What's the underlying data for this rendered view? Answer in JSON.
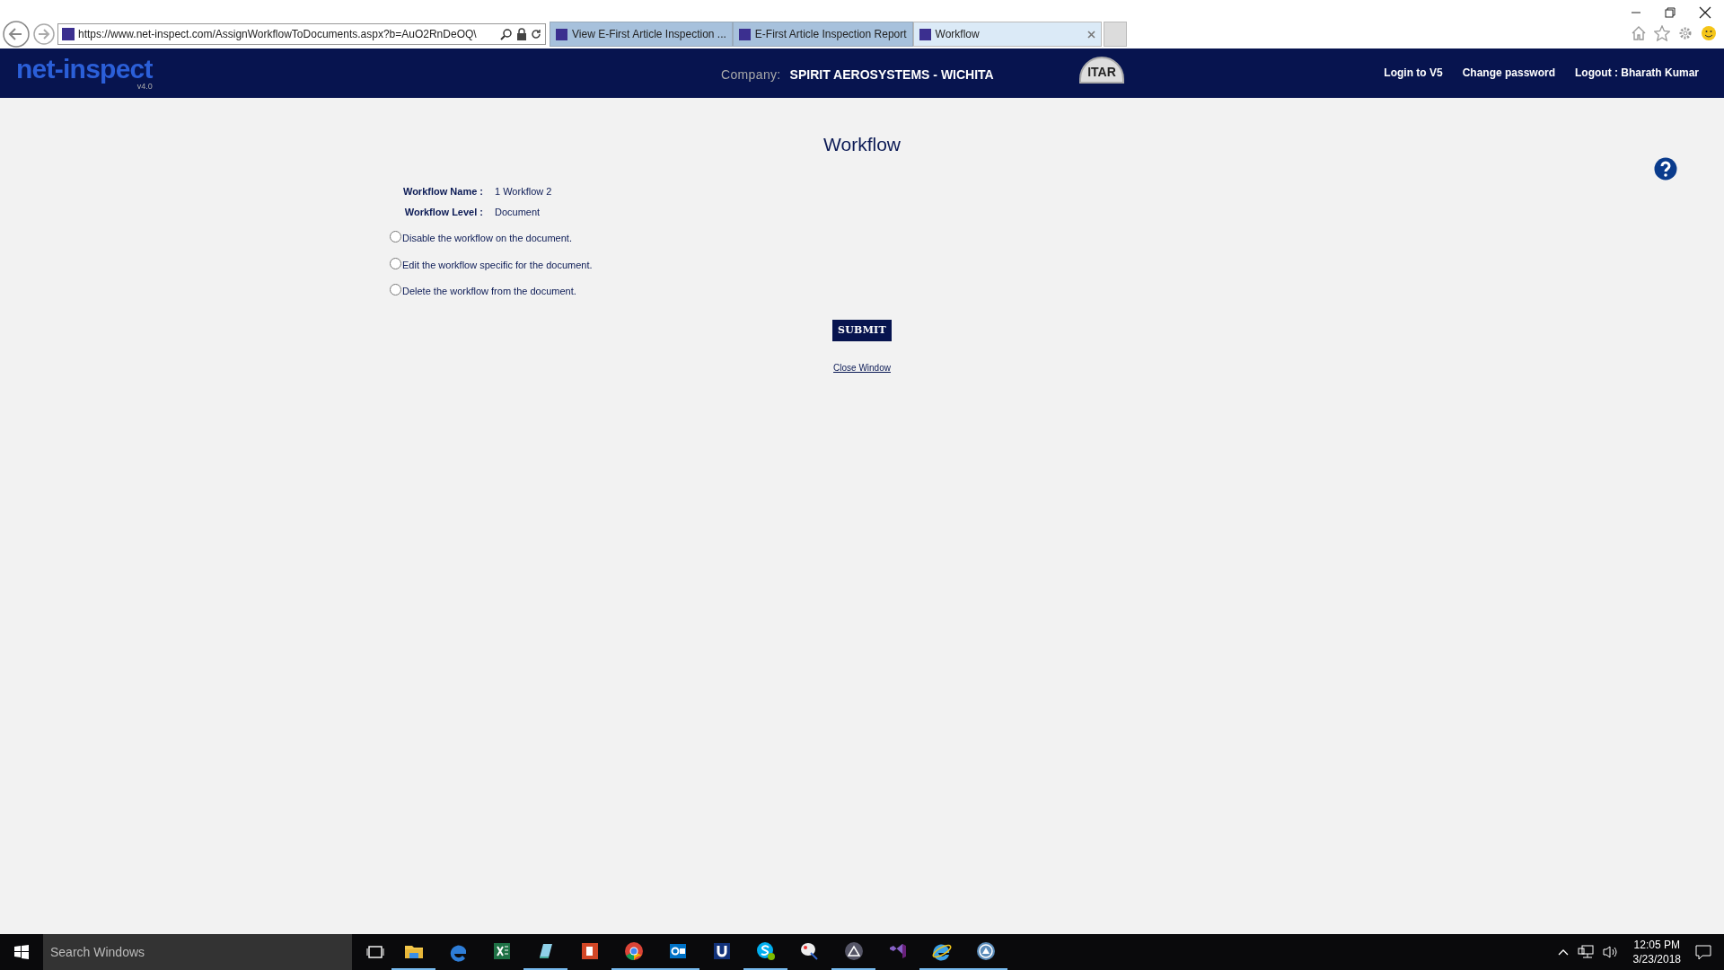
{
  "browser": {
    "address": "https://www.net-inspect.com/AssignWorkflowToDocuments.aspx?b=AuO2RnDeOQ\\",
    "tabs": [
      {
        "label": "View E-First Article Inspection ...",
        "selected": false
      },
      {
        "label": "E-First Article Inspection Report",
        "selected": false
      },
      {
        "label": "Workflow",
        "selected": true
      }
    ]
  },
  "header": {
    "logo": "net-inspect",
    "version": "v4.0",
    "company_label": "Company:",
    "company": "SPIRIT AEROSYSTEMS - WICHITA",
    "badge": "ITAR",
    "links": [
      "Login to V5",
      "Change password",
      "Logout : Bharath Kumar"
    ]
  },
  "page": {
    "title": "Workflow",
    "fields": [
      {
        "label": "Workflow Name :",
        "value": "1 Workflow 2"
      },
      {
        "label": "Workflow Level :",
        "value": "Document"
      }
    ],
    "options": [
      {
        "label": "Disable the workflow on the document.",
        "selected": false
      },
      {
        "label": "Edit the workflow specific for the document.",
        "selected": false
      },
      {
        "label": "Delete the workflow from the document.",
        "selected": false
      }
    ],
    "submit": "SUBMIT",
    "close_link": "Close Window"
  },
  "taskbar": {
    "search": {
      "placeholder": "Search Windows"
    },
    "apps": [
      {
        "kind": "folder",
        "running": true
      },
      {
        "kind": "edge",
        "running": false
      },
      {
        "kind": "excel",
        "running": false
      },
      {
        "kind": "notepad",
        "running": true
      },
      {
        "kind": "powerpoint",
        "running": false
      },
      {
        "kind": "chrome",
        "running": true
      },
      {
        "kind": "outlook",
        "running": true
      },
      {
        "kind": "u",
        "running": false
      },
      {
        "kind": "skype",
        "running": true
      },
      {
        "kind": "paint",
        "running": false
      },
      {
        "kind": "globe",
        "running": true
      },
      {
        "kind": "vs",
        "running": false
      },
      {
        "kind": "ie",
        "running": true
      },
      {
        "kind": "app",
        "running": true
      }
    ],
    "time": "12:05 PM",
    "date": "3/23/2018"
  }
}
